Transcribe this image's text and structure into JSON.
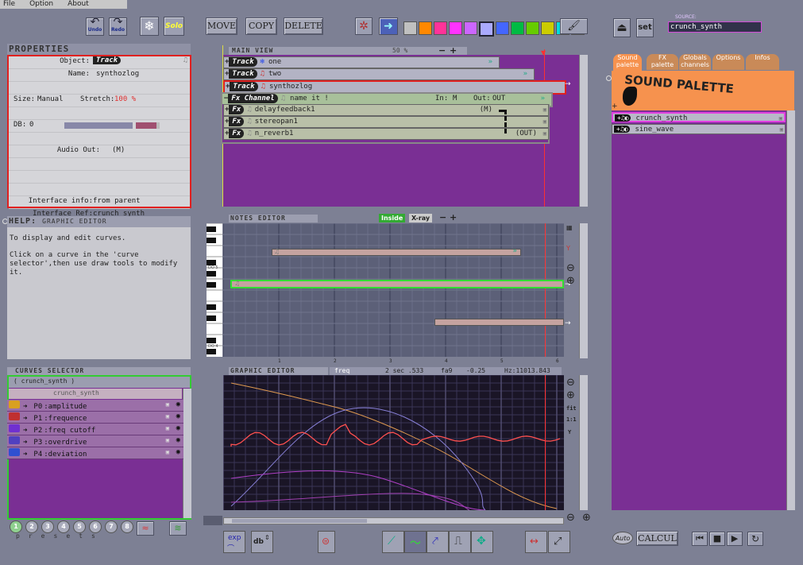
{
  "menu": [
    "File",
    "Option",
    "About"
  ],
  "toolbar": {
    "undo": "Undo",
    "redo": "Redo",
    "solo": "Solo",
    "move": "MOVE",
    "copy": "COPY",
    "delete": "DELETE",
    "set": "set",
    "source_label": "SOURCE:",
    "source_value": "crunch_synth",
    "colors": [
      "#c0c0c0",
      "#ff8800",
      "#ff3399",
      "#ff33ff",
      "#cc66ff",
      "#aaaaff",
      "#4466ff",
      "#00bb44",
      "#66cc00",
      "#cccc00",
      "#00dddd",
      "#00aaff"
    ]
  },
  "properties": {
    "title": "PROPERTIES",
    "object_label": "Object:",
    "object_value": "Track",
    "name_label": "Name:",
    "name_value": "synthozlog",
    "size_label": "Size:",
    "size_value": "Manual",
    "stretch_label": "Stretch:",
    "stretch_value": "100 %",
    "db_label": "DB:",
    "db_value": "0",
    "audio_label": "Audio Out:",
    "audio_value": "(M)",
    "iface_info_label": "Interface info:",
    "iface_info_value": "from parent",
    "iface_ref_label": "Interface Ref:",
    "iface_ref_value": "crunch_synth"
  },
  "help": {
    "title": "HELP:",
    "subtitle": "GRAPHIC EDITOR",
    "line1": "To display and edit curves.",
    "line2": "Click on a curve in the 'curve",
    "line3": "selector',then use draw tools to modify it."
  },
  "curves": {
    "title": "CURVES SELECTOR",
    "subtitle": "( crunch_synth )",
    "head": "crunch_synth",
    "items": [
      {
        "id": "P0",
        "label": ":amplitude"
      },
      {
        "id": "P1",
        "label": ":frequence"
      },
      {
        "id": "P2",
        "label": ":freq cutoff"
      },
      {
        "id": "P3",
        "label": ":overdrive"
      },
      {
        "id": "P4",
        "label": ":deviation"
      }
    ],
    "presets": [
      "1",
      "2",
      "3",
      "4",
      "5",
      "6",
      "7",
      "8"
    ],
    "presets_word": [
      "p",
      "r",
      "e",
      "s",
      "e",
      "t",
      "s"
    ]
  },
  "main_view": {
    "title": "MAIN VIEW",
    "zoom": "50 %",
    "tracks": [
      {
        "badge": "Track",
        "name": "one"
      },
      {
        "badge": "Track",
        "name": "two"
      },
      {
        "badge": "Track",
        "name": "synthozlog"
      }
    ],
    "fx_channel": {
      "badge": "Fx Channel",
      "name": "name it !",
      "in_label": "In:",
      "in_value": "M",
      "out_label": "Out:",
      "out_value": "OUT"
    },
    "fx": [
      {
        "badge": "Fx",
        "name": "delayfeedback1",
        "tag": "(M)"
      },
      {
        "badge": "Fx",
        "name": "stereopan1",
        "tag": ""
      },
      {
        "badge": "Fx",
        "name": "n_reverb1",
        "tag": "(OUT)"
      }
    ]
  },
  "notes_editor": {
    "title": "NOTES EDITOR",
    "inside": "Inside",
    "xray": "X-ray",
    "key_labels": [
      "DO 5",
      "DO 4"
    ],
    "ruler": [
      "1",
      "2",
      "3",
      "4",
      "5",
      "6"
    ]
  },
  "graphic_editor": {
    "title": "GRAPHIC EDITOR",
    "param": "freq",
    "time": "2 sec .533",
    "note": "fa9",
    "value": "-0.25",
    "hz": "Hz:11013.843",
    "side": [
      "fit",
      "1:1",
      "Y"
    ]
  },
  "sound_palette": {
    "tabs": [
      "Sound palette",
      "FX palette",
      "Globals channels",
      "Options",
      "Infos"
    ],
    "banner": "SOUND PALETTE",
    "items": [
      "crunch_synth",
      "sine_wave"
    ]
  },
  "transport": {
    "auto": "Auto",
    "calcul": "CALCUL"
  },
  "bottom_tools": {
    "exp": "exp",
    "db": "db"
  }
}
